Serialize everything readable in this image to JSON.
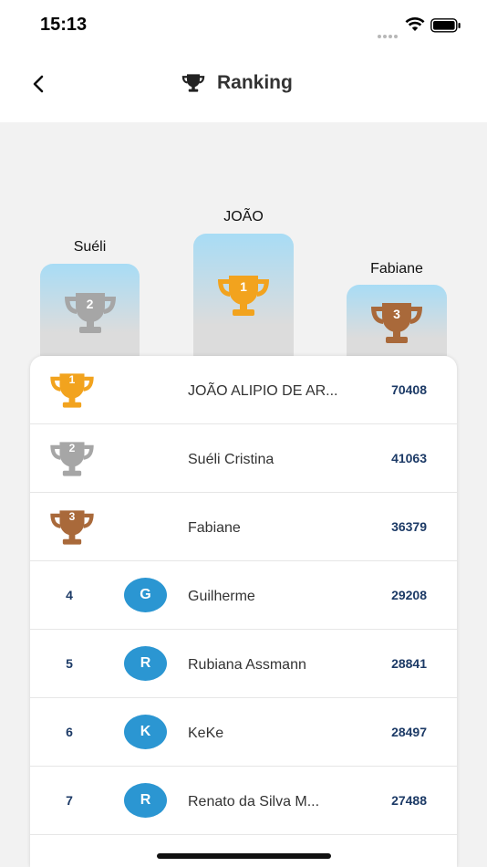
{
  "status_bar": {
    "time": "15:13"
  },
  "header": {
    "title": "Ranking"
  },
  "colors": {
    "gold": "#f2a31e",
    "silver": "#a6a6a6",
    "bronze": "#a9693a",
    "avatar": "#2b96d2",
    "score": "#1c3a66"
  },
  "podium": {
    "first": {
      "name": "JOÃO",
      "rank": "1"
    },
    "second": {
      "name": "Suéli",
      "rank": "2"
    },
    "third": {
      "name": "Fabiane",
      "rank": "3"
    }
  },
  "ranking": [
    {
      "rank": "1",
      "name": "JOÃO ALIPIO DE AR...",
      "score": "70408"
    },
    {
      "rank": "2",
      "name": "Suéli Cristina",
      "score": "41063"
    },
    {
      "rank": "3",
      "name": "Fabiane",
      "score": "36379"
    },
    {
      "rank": "4",
      "initial": "G",
      "name": "Guilherme",
      "score": "29208"
    },
    {
      "rank": "5",
      "initial": "R",
      "name": "Rubiana Assmann",
      "score": "28841"
    },
    {
      "rank": "6",
      "initial": "K",
      "name": "KeKe",
      "score": "28497"
    },
    {
      "rank": "7",
      "initial": "R",
      "name": "Renato da Silva M...",
      "score": "27488"
    }
  ]
}
